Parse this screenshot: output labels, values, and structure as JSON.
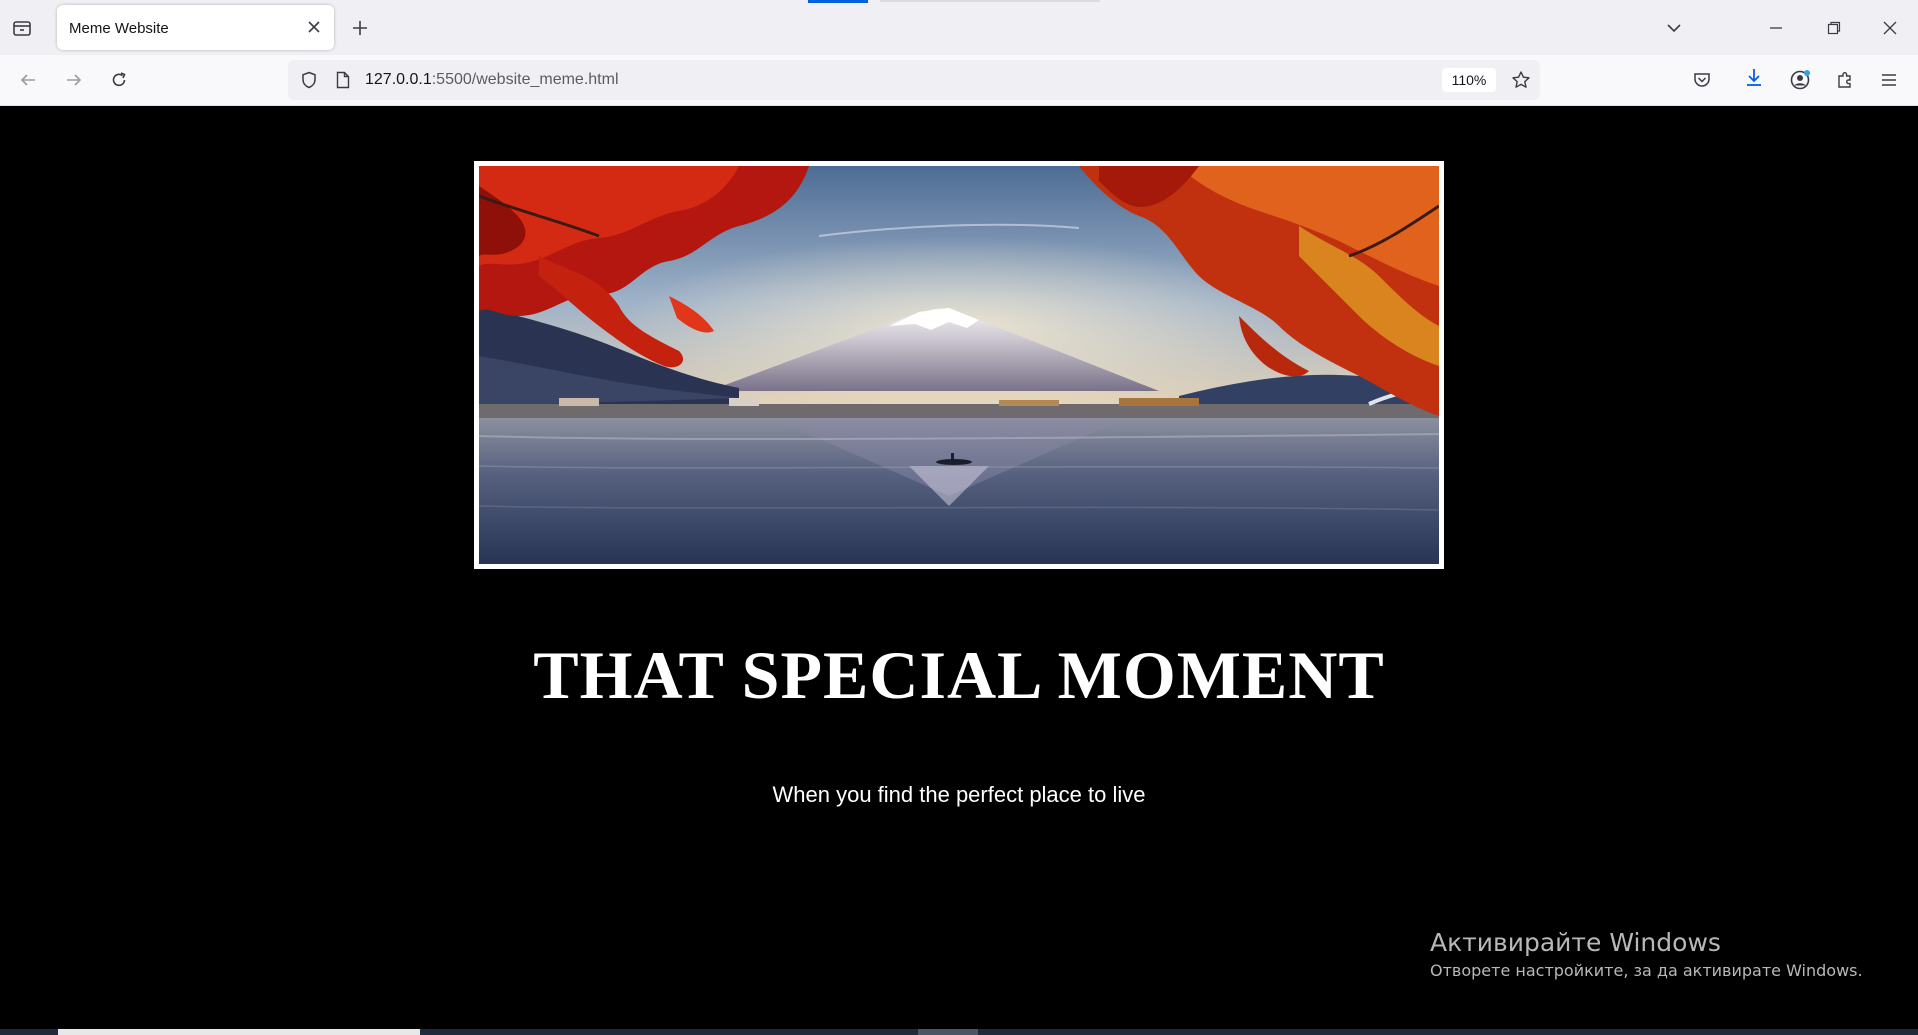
{
  "browser": {
    "tab_title": "Meme Website",
    "url_host": "127.0.0.1",
    "url_path": ":5500/website_meme.html",
    "zoom": "110%"
  },
  "page": {
    "headline": "THAT SPECIAL MOMENT",
    "subline": "When you find the perfect place to live"
  },
  "os": {
    "activation_title": "Активирайте Windows",
    "activation_sub": "Отворете настройките, за да активирате Windows."
  },
  "icons": {
    "tab_list": "tab-list-icon",
    "close_tab": "close-icon",
    "new_tab": "plus-icon",
    "list_tabs": "chevron-down-icon",
    "minimize": "minimize-icon",
    "restore": "restore-icon",
    "close_window": "close-icon",
    "back": "arrow-left-icon",
    "forward": "arrow-right-icon",
    "reload": "reload-icon",
    "tracking": "shield-icon",
    "page_info": "page-icon",
    "bookmark": "star-icon",
    "pocket": "pocket-icon",
    "downloads": "download-icon",
    "account": "account-icon",
    "extensions": "puzzle-icon",
    "menu": "hamburger-icon"
  },
  "colors": {
    "page_background": "#000000",
    "accent": "#0061e0"
  }
}
